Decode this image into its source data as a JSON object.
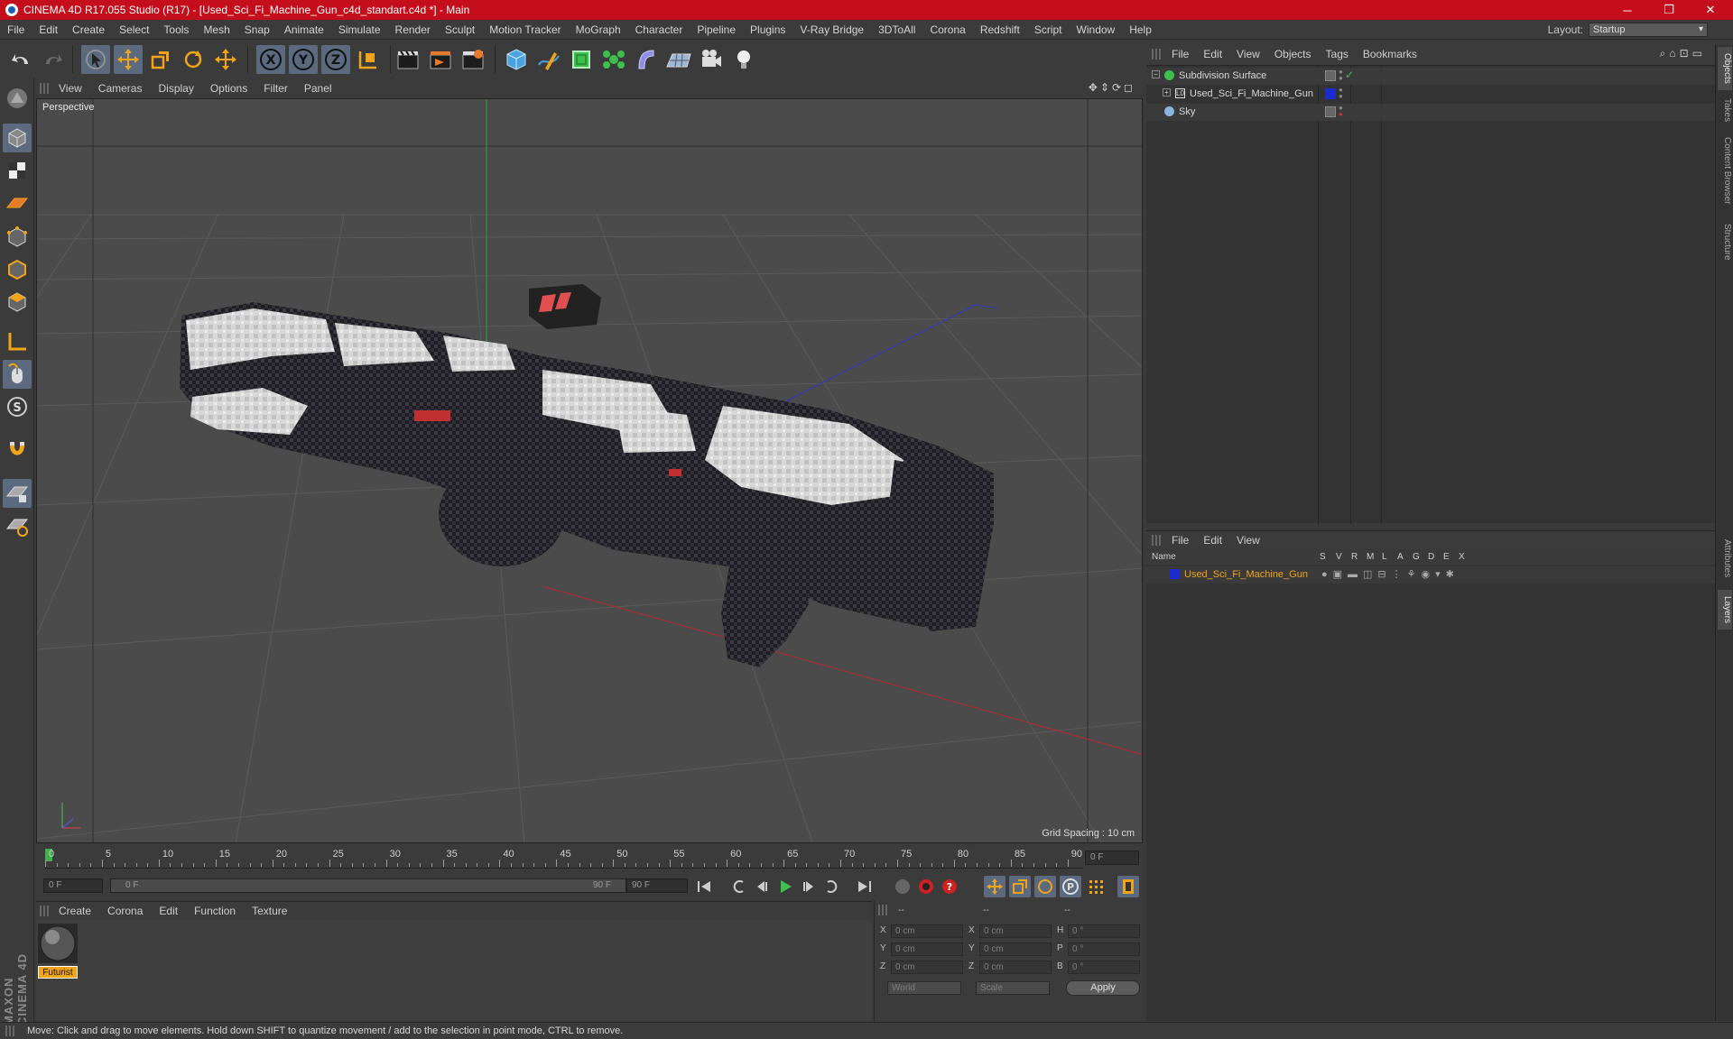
{
  "window": {
    "title": "CINEMA 4D R17.055 Studio (R17) - [Used_Sci_Fi_Machine_Gun_c4d_standart.c4d *] - Main",
    "minimize": "─",
    "restore": "❐",
    "close": "✕"
  },
  "menu": [
    "File",
    "Edit",
    "Create",
    "Select",
    "Tools",
    "Mesh",
    "Snap",
    "Animate",
    "Simulate",
    "Render",
    "Sculpt",
    "Motion Tracker",
    "MoGraph",
    "Character",
    "Pipeline",
    "Plugins",
    "V-Ray Bridge",
    "3DToAll",
    "Corona",
    "Redshift",
    "Script",
    "Window",
    "Help"
  ],
  "layout": {
    "label": "Layout:",
    "value": "Startup"
  },
  "toolbar": {
    "axis_x": "X",
    "axis_y": "Y",
    "axis_z": "Z"
  },
  "viewport": {
    "menu": [
      "View",
      "Cameras",
      "Display",
      "Options",
      "Filter",
      "Panel"
    ],
    "label": "Perspective",
    "grid_spacing": "Grid Spacing : 10 cm"
  },
  "timeline": {
    "ticks": [
      "0",
      "5",
      "10",
      "15",
      "20",
      "25",
      "30",
      "35",
      "40",
      "45",
      "50",
      "55",
      "60",
      "65",
      "70",
      "75",
      "80",
      "85",
      "90"
    ],
    "current_frame": "0 F",
    "start_field": "0 F",
    "range_start": "0 F",
    "range_end": "90 F",
    "end_field": "90 F"
  },
  "material_manager": {
    "menu": [
      "Create",
      "Corona",
      "Edit",
      "Function",
      "Texture"
    ],
    "materials": [
      {
        "name": "Futurist"
      }
    ]
  },
  "coordinates": {
    "header": [
      "--",
      "--",
      "--"
    ],
    "rows": [
      {
        "a": "X",
        "av": "0 cm",
        "b": "X",
        "bv": "0 cm",
        "c": "H",
        "cv": "0 °"
      },
      {
        "a": "Y",
        "av": "0 cm",
        "b": "Y",
        "bv": "0 cm",
        "c": "P",
        "cv": "0 °"
      },
      {
        "a": "Z",
        "av": "0 cm",
        "b": "Z",
        "bv": "0 cm",
        "c": "B",
        "cv": "0 °"
      }
    ],
    "mode": "World",
    "scale": "Scale",
    "apply": "Apply"
  },
  "object_manager": {
    "menu": [
      "File",
      "Edit",
      "View",
      "Objects",
      "Tags",
      "Bookmarks"
    ],
    "objects": [
      {
        "name": "Subdivision Surface",
        "icon": "subdivision-icon"
      },
      {
        "name": "Used_Sci_Fi_Machine_Gun",
        "icon": "null-icon"
      },
      {
        "name": "Sky",
        "icon": "sky-icon"
      }
    ]
  },
  "layer_manager": {
    "menu": [
      "File",
      "Edit",
      "View"
    ],
    "columns": {
      "name": "Name",
      "flags": [
        "S",
        "V",
        "R",
        "M",
        "L",
        "A",
        "G",
        "D",
        "E",
        "X"
      ]
    },
    "layers": [
      {
        "name": "Used_Sci_Fi_Machine_Gun",
        "color": "#1b2bd1"
      }
    ]
  },
  "side_tabs": [
    "Objects",
    "Takes",
    "Content Browser",
    "Structure",
    "Attributes",
    "Layers"
  ],
  "brand": "MAXON CINEMA 4D",
  "status": "Move: Click and drag to move elements. Hold down SHIFT to quantize movement / add to the selection in point mode, CTRL to remove.",
  "colors": {
    "title_bar": "#c40e1b",
    "accent": "#f2a419",
    "highlight": "#5b6a7e"
  }
}
